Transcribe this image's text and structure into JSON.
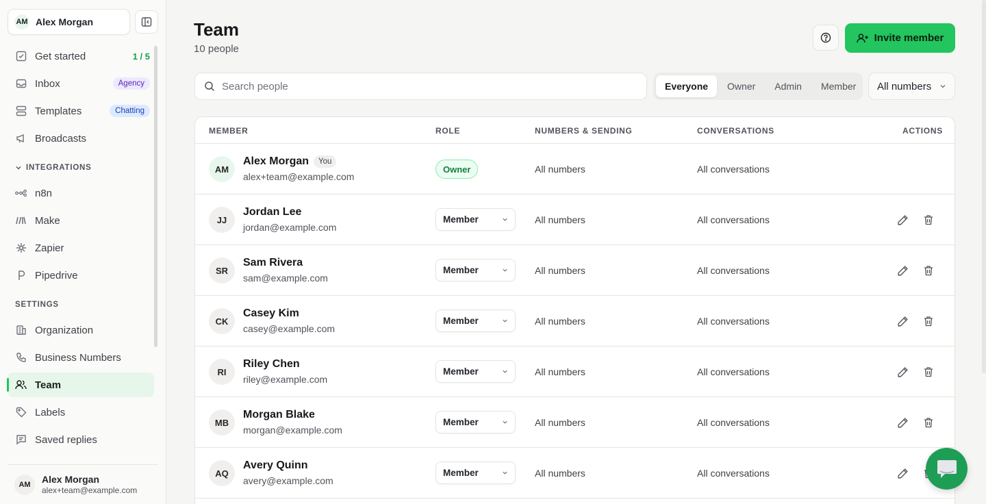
{
  "workspace": {
    "initials": "AM",
    "name": "Alex Morgan"
  },
  "sidebar": {
    "items": [
      {
        "label": "Get started",
        "count": "1 / 5"
      },
      {
        "label": "Inbox",
        "badge": "Agency"
      },
      {
        "label": "Templates",
        "badge": "Chatting"
      },
      {
        "label": "Broadcasts"
      }
    ],
    "integrations_title": "INTEGRATIONS",
    "integrations": [
      {
        "label": "n8n"
      },
      {
        "label": "Make"
      },
      {
        "label": "Zapier"
      },
      {
        "label": "Pipedrive"
      }
    ],
    "settings_title": "SETTINGS",
    "settings": [
      {
        "label": "Organization"
      },
      {
        "label": "Business Numbers"
      },
      {
        "label": "Team"
      },
      {
        "label": "Labels"
      },
      {
        "label": "Saved replies"
      }
    ]
  },
  "user": {
    "initials": "AM",
    "name": "Alex Morgan",
    "email": "alex+team@example.com"
  },
  "header": {
    "title": "Team",
    "subtitle": "10 people",
    "invite_label": "Invite member"
  },
  "filters": {
    "search_placeholder": "Search people",
    "roles": [
      "Everyone",
      "Owner",
      "Admin",
      "Member"
    ],
    "active_role": "Everyone",
    "numbers_select": "All numbers"
  },
  "table": {
    "headers": {
      "member": "MEMBER",
      "role": "ROLE",
      "numbers": "NUMBERS & SENDING",
      "conversations": "CONVERSATIONS",
      "actions": "ACTIONS"
    },
    "rows": [
      {
        "initials": "AM",
        "name": "Alex Morgan",
        "you": "You",
        "email": "alex+team@example.com",
        "role": "Owner",
        "numbers": "All numbers",
        "conversations": "All conversations"
      },
      {
        "initials": "JJ",
        "name": "Jordan Lee",
        "email": "jordan@example.com",
        "role": "Member",
        "numbers": "All numbers",
        "conversations": "All conversations"
      },
      {
        "initials": "SR",
        "name": "Sam Rivera",
        "email": "sam@example.com",
        "role": "Member",
        "numbers": "All numbers",
        "conversations": "All conversations"
      },
      {
        "initials": "CK",
        "name": "Casey Kim",
        "email": "casey@example.com",
        "role": "Member",
        "numbers": "All numbers",
        "conversations": "All conversations"
      },
      {
        "initials": "RI",
        "name": "Riley Chen",
        "email": "riley@example.com",
        "role": "Member",
        "numbers": "All numbers",
        "conversations": "All conversations"
      },
      {
        "initials": "MB",
        "name": "Morgan Blake",
        "email": "morgan@example.com",
        "role": "Member",
        "numbers": "All numbers",
        "conversations": "All conversations"
      },
      {
        "initials": "AQ",
        "name": "Avery Quinn",
        "email": "avery@example.com",
        "role": "Member",
        "numbers": "All numbers",
        "conversations": "All conversations"
      }
    ]
  },
  "colors": {
    "accent": "#22c55e",
    "accent_soft": "#e6f6ea"
  }
}
